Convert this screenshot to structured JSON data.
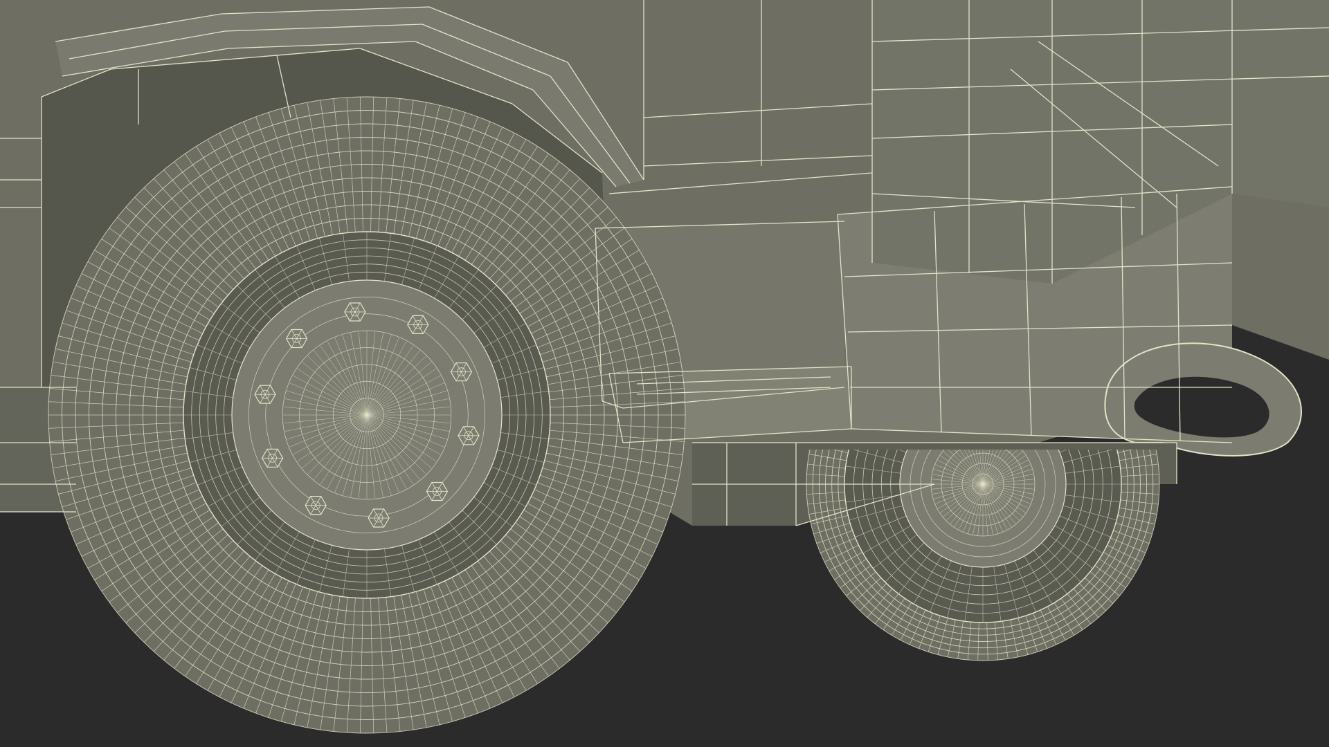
{
  "scene": {
    "subject": "3d-wireframe-vehicle-wheels",
    "colors": {
      "background": "#2b2b2b",
      "surface": "#6e6f62",
      "surface_dark": "#5a5b50",
      "surface_light": "#7c7d70",
      "wire": "#e4e2c8",
      "wire_dim": "#c9c7ad"
    }
  }
}
